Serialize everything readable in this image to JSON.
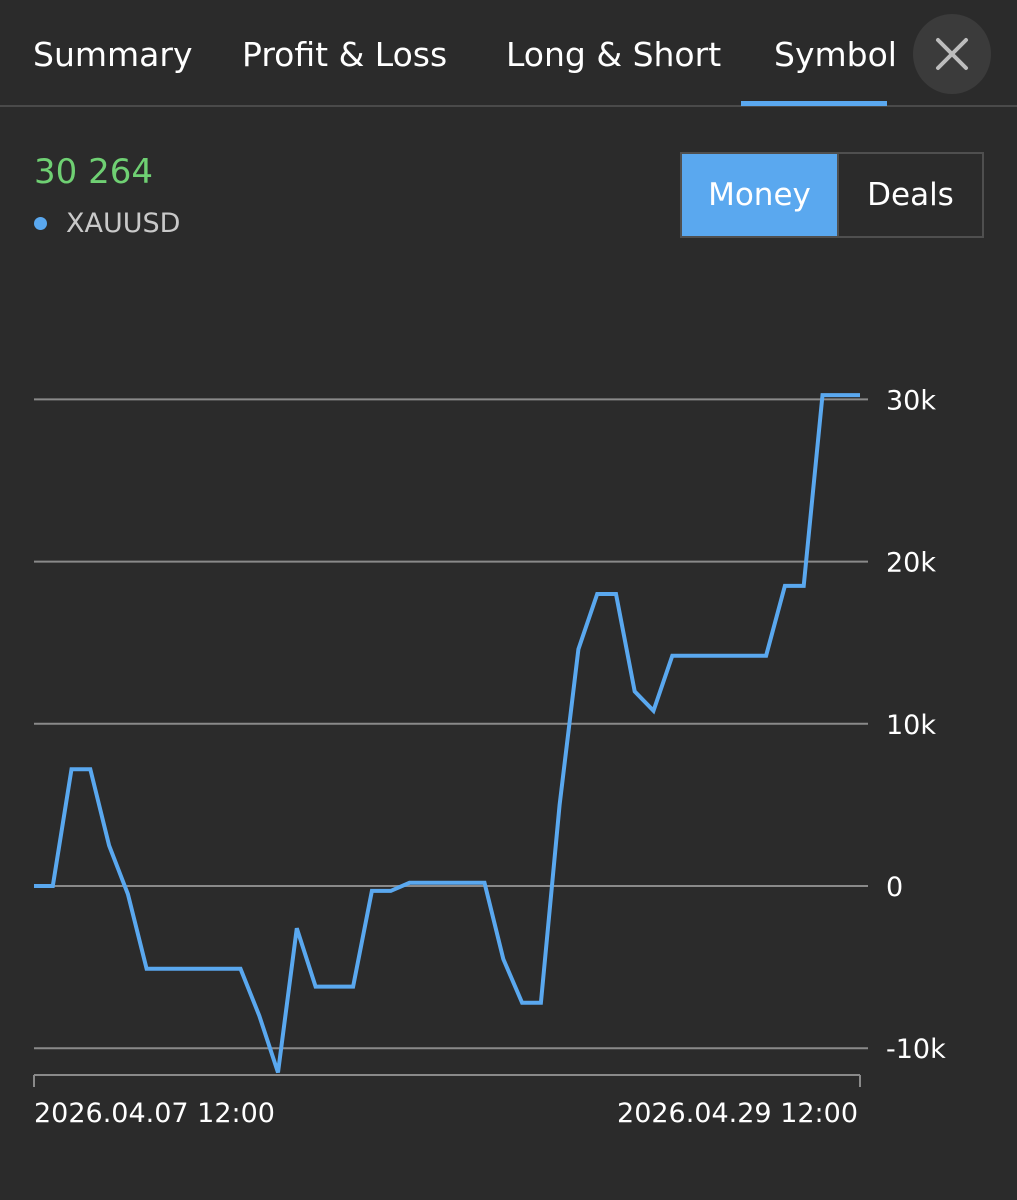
{
  "tabs": [
    {
      "label": "Summary",
      "active": false
    },
    {
      "label": "Profit & Loss",
      "active": false
    },
    {
      "label": "Long & Short",
      "active": false
    },
    {
      "label": "Symbol",
      "active": true
    }
  ],
  "close_icon": "close-icon",
  "summary": {
    "total_value": "30 264",
    "total_color": "#6fd073"
  },
  "legend": {
    "label": "XAUUSD",
    "color": "#5aa8ef"
  },
  "toggle": {
    "money_label": "Money",
    "deals_label": "Deals",
    "selected": "Money"
  },
  "colors": {
    "accent": "#5aa8ef",
    "background": "#2b2b2b",
    "gridline": "#8a8a8a"
  },
  "chart_data": {
    "type": "line",
    "ylim": [
      -11500,
      30500
    ],
    "yticks": [
      -10000,
      0,
      10000,
      20000,
      30000
    ],
    "ytick_labels": [
      "-10k",
      "0",
      "10k",
      "20k",
      "30k"
    ],
    "xtick_labels": [
      "2026.04.07 12:00",
      "2026.04.29 12:00"
    ],
    "grid": true,
    "series": [
      {
        "name": "XAUUSD",
        "color": "#5aa8ef",
        "x": [
          0,
          1,
          2,
          3,
          4,
          5,
          6,
          7,
          8,
          9,
          10,
          11,
          12,
          13,
          14,
          15,
          16,
          17,
          18,
          19,
          20,
          21,
          22,
          23,
          24,
          25,
          26,
          27,
          28,
          29,
          30,
          31,
          32,
          33,
          34,
          35,
          36,
          37,
          38,
          39,
          40,
          41,
          42,
          43,
          44
        ],
        "values": [
          0,
          0,
          7200,
          7200,
          2500,
          -500,
          -5100,
          -5100,
          -5100,
          -5100,
          -5100,
          -5100,
          -8000,
          -11500,
          -2600,
          -6200,
          -6200,
          -6200,
          -300,
          -300,
          200,
          200,
          200,
          200,
          200,
          -4500,
          -7200,
          -7200,
          5000,
          14600,
          18000,
          18000,
          12000,
          10800,
          14200,
          14200,
          14200,
          14200,
          14200,
          14200,
          18500,
          18500,
          30264,
          30264,
          30264
        ]
      }
    ]
  }
}
